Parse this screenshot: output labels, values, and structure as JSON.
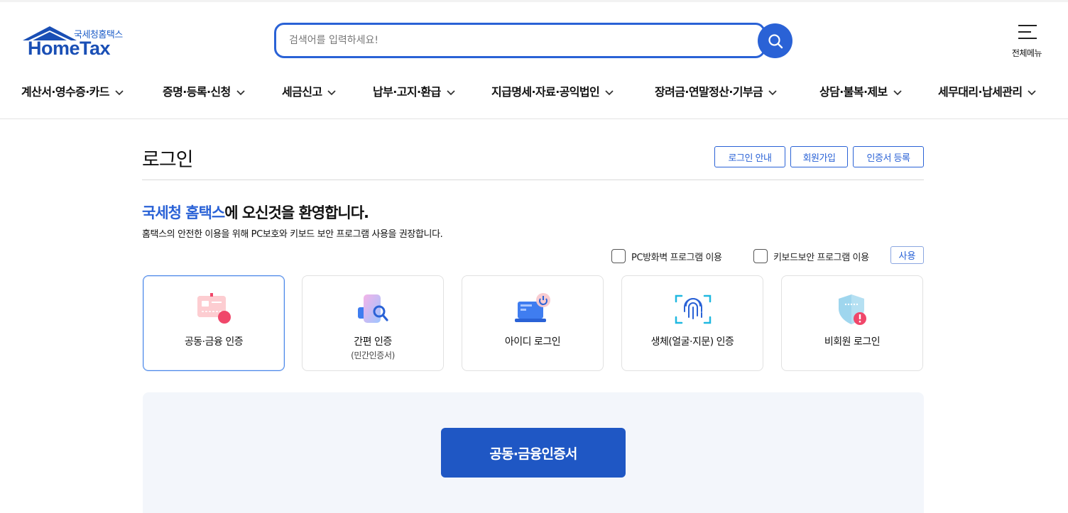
{
  "header": {
    "logo_sub": "국세청홈택스",
    "logo_main": "HomeTax",
    "search": {
      "placeholder": "검색어를 입력하세요!",
      "value": ""
    },
    "all_menu_label": "전체메뉴"
  },
  "gnb": [
    {
      "label": "계산서·영수증·카드"
    },
    {
      "label": "증명·등록·신청"
    },
    {
      "label": "세금신고"
    },
    {
      "label": "납부·고지·환급"
    },
    {
      "label": "지급명세·자료·공익법인"
    },
    {
      "label": "장려금·연말정산·기부금"
    },
    {
      "label": "상담·불복·제보"
    },
    {
      "label": "세무대리·납세관리"
    }
  ],
  "page": {
    "title": "로그인",
    "top_buttons": [
      "로그인 안내",
      "회원가입",
      "인증서 등록"
    ],
    "welcome_highlight": "국세청 홈택스",
    "welcome_rest": "에 오신것을 환영합니다.",
    "welcome_desc": "홈택스의 안전한 이용을 위해 PC보호와 키보드 보안 프로그램 사용을 권장합니다.",
    "checks": [
      "PC방화벽 프로그램 이용",
      "키보드보안 프로그램 이용"
    ],
    "use_button": "사용"
  },
  "login_methods": [
    {
      "label": "공동·금융 인증",
      "sub": "",
      "icon": "certificate-card-icon",
      "active": true
    },
    {
      "label": "간편 인증",
      "sub": "(민간인증서)",
      "icon": "phone-search-icon",
      "active": false
    },
    {
      "label": "아이디 로그인",
      "sub": "",
      "icon": "laptop-power-icon",
      "active": false
    },
    {
      "label": "생체(얼굴·지문) 인증",
      "sub": "",
      "icon": "fingerprint-icon",
      "active": false
    },
    {
      "label": "비회원 로그인",
      "sub": "",
      "icon": "shield-alert-icon",
      "active": false
    }
  ],
  "login_panel": {
    "primary_button": "공동·금융인증서"
  },
  "colors": {
    "brand": "#1a4fb5",
    "accent": "#2a62d6",
    "primary_button": "#1f57c4",
    "panel_bg": "#f3f6fb"
  }
}
